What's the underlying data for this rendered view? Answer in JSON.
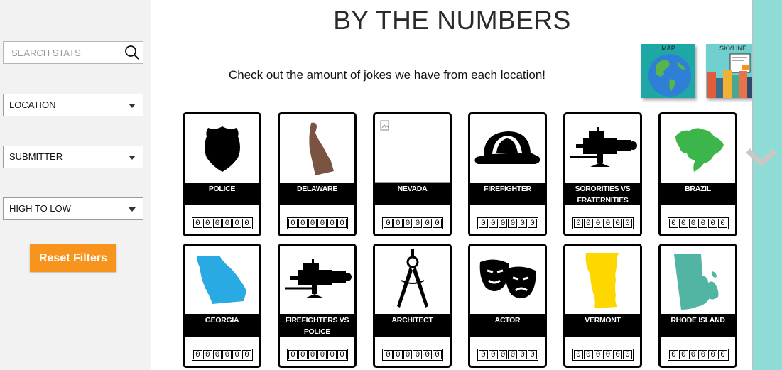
{
  "sidebar": {
    "search_placeholder": "SEARCH STATS",
    "filters": [
      {
        "name": "location",
        "value": "LOCATION"
      },
      {
        "name": "submitter",
        "value": "SUBMITTER"
      },
      {
        "name": "sort",
        "value": "HIGH TO LOW"
      }
    ],
    "reset_label": "Reset Filters"
  },
  "main": {
    "title": "BY THE NUMBERS",
    "subtitle": "Check out the amount of jokes we have from each location!"
  },
  "views": [
    {
      "label": "MAP",
      "icon": "globe-icon"
    },
    {
      "label": "SKYLINE",
      "icon": "skyline-icon"
    }
  ],
  "colors": {
    "accent_orange": "#f7941d",
    "right_rail": "#8fdcd6",
    "delaware": "#7b5343",
    "brazil": "#3cb54a",
    "georgia": "#29aae2",
    "vermont": "#ffd700",
    "rhode_island": "#52b5a3"
  },
  "cards": [
    {
      "label": "POLICE",
      "count": "000000",
      "icon": "police-badge-icon"
    },
    {
      "label": "DELAWARE",
      "count": "000000",
      "icon": "delaware-map-icon"
    },
    {
      "label": "NEVADA",
      "count": "000000",
      "icon": "broken-image-icon"
    },
    {
      "label": "FIREFIGHTER",
      "count": "000000",
      "icon": "fire-helmet-icon"
    },
    {
      "label": "SORORITIES VS FRATERNITIES",
      "count": "000000",
      "icon": "video-camera-icon"
    },
    {
      "label": "BRAZIL",
      "count": "000000",
      "icon": "brazil-map-icon"
    },
    {
      "label": "GEORGIA",
      "count": "000000",
      "icon": "georgia-map-icon"
    },
    {
      "label": "FIREFIGHTERS VS POLICE",
      "count": "000000",
      "icon": "video-camera-icon"
    },
    {
      "label": "ARCHITECT",
      "count": "000000",
      "icon": "compass-icon"
    },
    {
      "label": "ACTOR",
      "count": "000000",
      "icon": "theater-masks-icon"
    },
    {
      "label": "VERMONT",
      "count": "000000",
      "icon": "vermont-map-icon"
    },
    {
      "label": "RHODE ISLAND",
      "count": "000000",
      "icon": "rhode-island-map-icon"
    }
  ]
}
